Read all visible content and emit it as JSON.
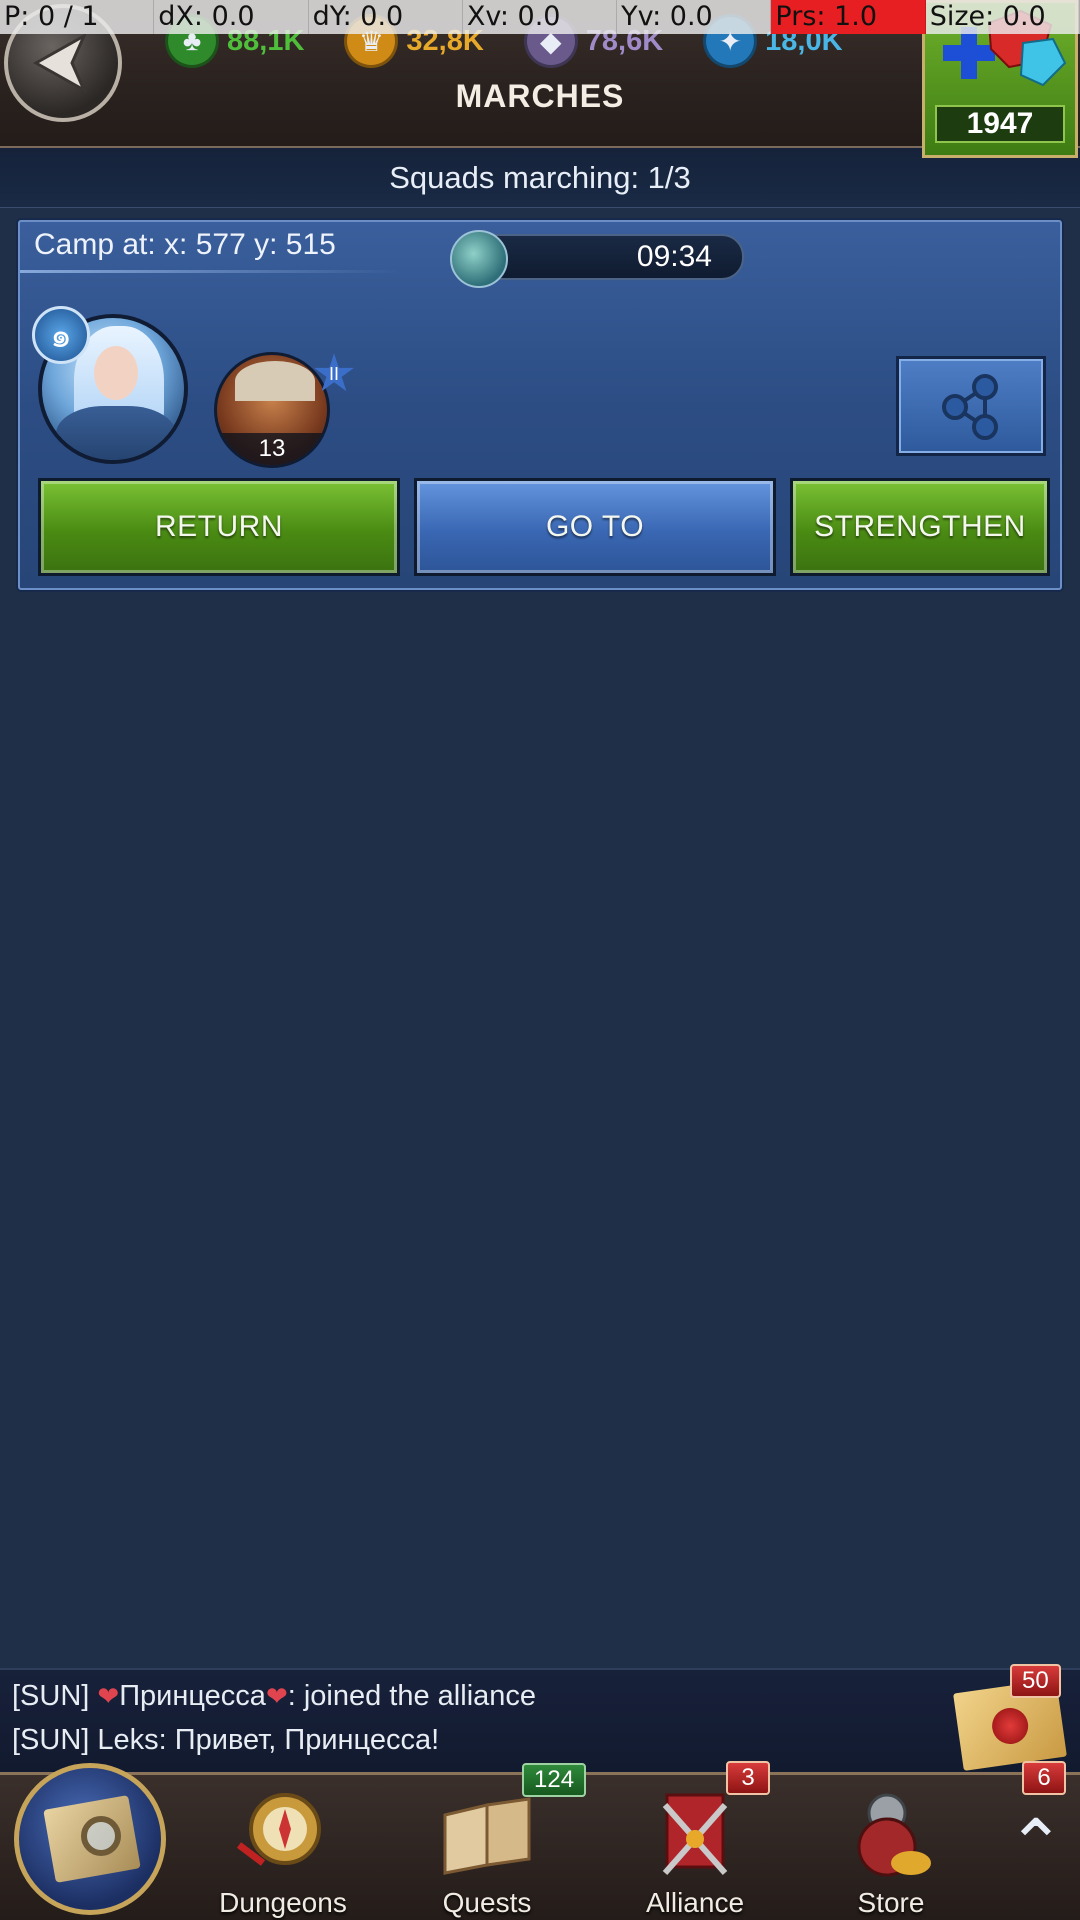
{
  "debug": {
    "pointer": "P: 0 / 1",
    "dx": "dX: 0.0",
    "dy": "dY: 0.0",
    "xv": "Xv: 0.0",
    "yv": "Yv: 0.0",
    "prs": "Prs: 1.0",
    "size": "Size: 0.0"
  },
  "header": {
    "title": "MARCHES",
    "resources": [
      {
        "icon": "wood-icon",
        "value": "88,1K",
        "color": "#4fbf3b"
      },
      {
        "icon": "gold-icon",
        "value": "32,8K",
        "color": "#e8a92a"
      },
      {
        "icon": "stone-icon",
        "value": "78,6K",
        "color": "#a08ac8"
      },
      {
        "icon": "mana-icon",
        "value": "18,0K",
        "color": "#4ab6e6"
      }
    ],
    "gems": "1947"
  },
  "squads_status": "Squads marching: 1/3",
  "squad": {
    "camp_label": "Camp at: x: 577 y: 515",
    "timer": "09:34",
    "secondary_hero_level": "13",
    "secondary_hero_rank": "II",
    "buttons": {
      "return": "RETURN",
      "goto": "GO TO",
      "strengthen": "STRENGTHEN"
    }
  },
  "chat": {
    "line1_prefix": "[SUN] ",
    "line1_name": "Принцесса",
    "line1_rest": ":  joined the alliance",
    "line2": "[SUN] Leks: Привет, Принцесса!",
    "mail_count": "50"
  },
  "nav": {
    "items": [
      {
        "label": "Dungeons",
        "badge": ""
      },
      {
        "label": "Quests",
        "badge": "124"
      },
      {
        "label": "Alliance",
        "badge": "3"
      },
      {
        "label": "Store",
        "badge": ""
      }
    ],
    "more_badge": "6"
  },
  "colors": {
    "accent_green": "#5c9e1f",
    "accent_blue": "#3a67b3",
    "background": "#1f2f48"
  }
}
